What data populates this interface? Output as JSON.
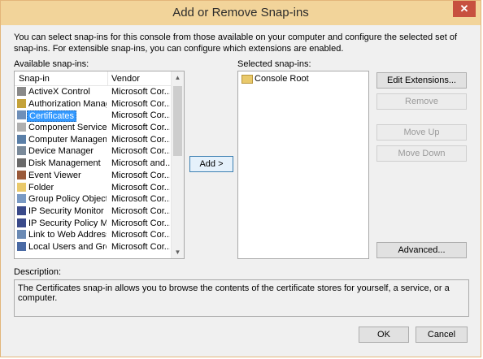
{
  "window": {
    "title": "Add or Remove Snap-ins",
    "close_label": "✕"
  },
  "intro": "You can select snap-ins for this console from those available on your computer and configure the selected set of snap-ins. For extensible snap-ins, you can configure which extensions are enabled.",
  "available": {
    "label": "Available snap-ins:",
    "col_snapin": "Snap-in",
    "col_vendor": "Vendor",
    "items": [
      {
        "name": "ActiveX Control",
        "vendor": "Microsoft Cor...",
        "icon": "activex-icon"
      },
      {
        "name": "Authorization Manager",
        "vendor": "Microsoft Cor...",
        "icon": "authorization-icon"
      },
      {
        "name": "Certificates",
        "vendor": "Microsoft Cor...",
        "icon": "certificates-icon",
        "selected": true
      },
      {
        "name": "Component Services",
        "vendor": "Microsoft Cor...",
        "icon": "component-services-icon"
      },
      {
        "name": "Computer Managem...",
        "vendor": "Microsoft Cor...",
        "icon": "computer-management-icon"
      },
      {
        "name": "Device Manager",
        "vendor": "Microsoft Cor...",
        "icon": "device-manager-icon"
      },
      {
        "name": "Disk Management",
        "vendor": "Microsoft and...",
        "icon": "disk-management-icon"
      },
      {
        "name": "Event Viewer",
        "vendor": "Microsoft Cor...",
        "icon": "event-viewer-icon"
      },
      {
        "name": "Folder",
        "vendor": "Microsoft Cor...",
        "icon": "folder-icon"
      },
      {
        "name": "Group Policy Object ...",
        "vendor": "Microsoft Cor...",
        "icon": "group-policy-icon"
      },
      {
        "name": "IP Security Monitor",
        "vendor": "Microsoft Cor...",
        "icon": "ip-security-monitor-icon"
      },
      {
        "name": "IP Security Policy Ma...",
        "vendor": "Microsoft Cor...",
        "icon": "ip-security-policy-icon"
      },
      {
        "name": "Link to Web Address",
        "vendor": "Microsoft Cor...",
        "icon": "web-link-icon"
      },
      {
        "name": "Local Users and Gro...",
        "vendor": "Microsoft Cor...",
        "icon": "local-users-icon"
      }
    ]
  },
  "add_button": "Add >",
  "selected": {
    "label": "Selected snap-ins:",
    "items": [
      "Console Root"
    ]
  },
  "buttons": {
    "edit_extensions": "Edit Extensions...",
    "remove": "Remove",
    "move_up": "Move Up",
    "move_down": "Move Down",
    "advanced": "Advanced...",
    "ok": "OK",
    "cancel": "Cancel"
  },
  "description": {
    "label": "Description:",
    "text": "The Certificates snap-in allows you to browse the contents of the certificate stores for yourself, a service, or a computer."
  },
  "colors": {
    "title_bar": "#f2d49a",
    "close_button": "#c7503f",
    "selection": "#3399ff"
  }
}
